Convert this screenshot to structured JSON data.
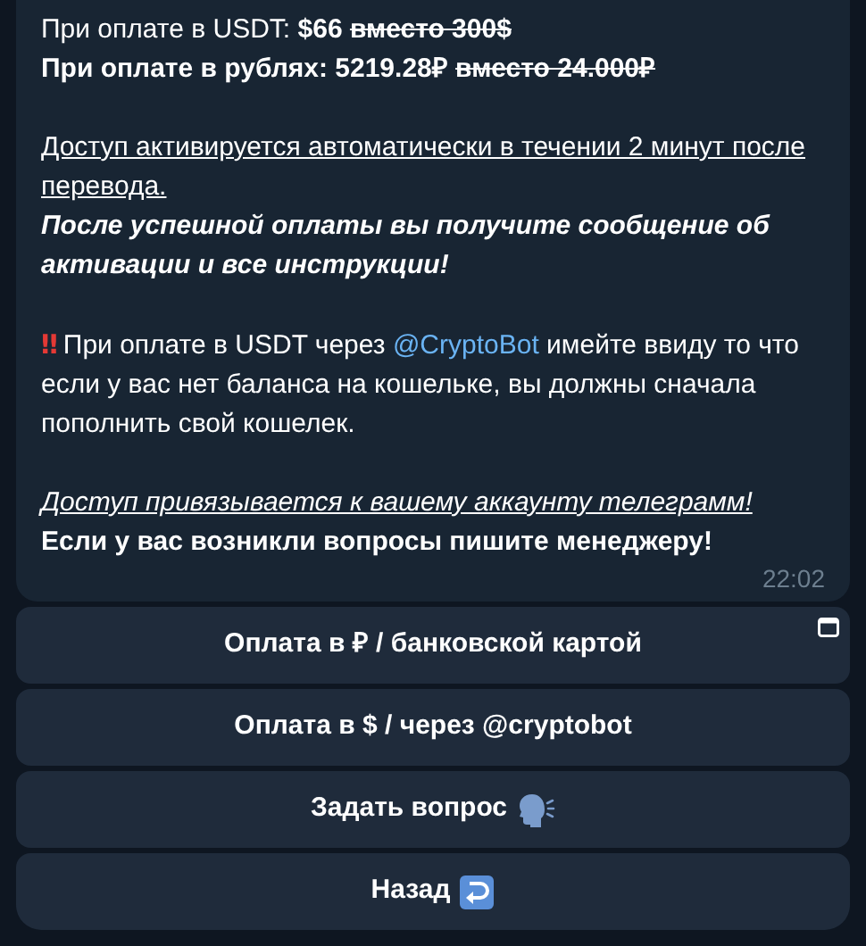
{
  "message": {
    "price_lines": [
      {
        "segments": [
          {
            "text": "При оплате в USDT: ",
            "bold": false,
            "strike": false
          },
          {
            "text": "$66 ",
            "bold": true,
            "strike": false
          },
          {
            "text": "вместо 300$",
            "bold": true,
            "strike": true
          }
        ]
      },
      {
        "segments": [
          {
            "text": "При оплате в рублях: 5219.28₽ ",
            "bold": true,
            "strike": false
          },
          {
            "text": "вместо 24.000₽",
            "bold": true,
            "strike": true
          }
        ]
      }
    ],
    "activation_note": "Доступ активируется автоматически в течении 2 минут после перевода.",
    "success_note": "После успешной оплаты вы получите сообщение об активации и все инструкции!",
    "warning": [
      {
        "kind": "alert",
        "text": "‼"
      },
      {
        "kind": "text",
        "text": "При оплате в USDT через "
      },
      {
        "kind": "mention",
        "text": "@CryptoBot"
      },
      {
        "kind": "text",
        "text": " имейте ввиду то что если у вас нет баланса на кошельке, вы должны сначала пополнить свой кошелек."
      }
    ],
    "binding_note": "Доступ привязывается к вашему аккаунту телеграмм!",
    "questions_note": "Если у вас возникли вопросы пишите менеджеру!",
    "time": "22:02"
  },
  "buttons": [
    {
      "label": "Оплата в ₽ / банковской картой",
      "kind": "webapp"
    },
    {
      "label": "Оплата в $ / через @cryptobot",
      "kind": "plain"
    },
    {
      "label": "Задать вопрос",
      "kind": "question"
    },
    {
      "label": "Назад",
      "kind": "back"
    }
  ]
}
